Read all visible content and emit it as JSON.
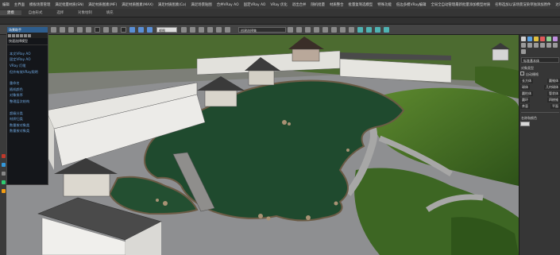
{
  "menu": {
    "items": [
      "编辑",
      "主界面",
      "模板场景管理",
      "满足批量材质(SN)",
      "满足材质图素(MF)",
      "满足材质图素(MAX)",
      "满足材质图素(Co)",
      "满足场景贴图",
      "合并VRay AO",
      "固定VRay AO",
      "VRay 优化",
      "退出合并",
      "随机批量",
      "材质整合",
      "批量复制选模型",
      "特殊功能",
      "低边多模VRay编辑",
      "全局全自动管理最新批量添加模型材质",
      "名称选加以该场景渲染单独添加原件",
      "达可以使用全部文件路"
    ]
  },
  "tabs": {
    "items": [
      "建模",
      "自由形式",
      "选择",
      "对象绘制",
      "填充"
    ],
    "active_index": 0
  },
  "toolbar": {
    "view_select": "视图",
    "set_select": "创建选择集",
    "icon_names": [
      "undo-icon",
      "redo-icon",
      "link-icon",
      "unlink-icon",
      "bind-icon",
      "select-icon",
      "select-name-icon",
      "rect-select-icon",
      "window-icon",
      "move-icon",
      "rotate-icon",
      "scale-icon",
      "ref-coord-icon",
      "pivot-icon",
      "snap-icon",
      "angle-snap-icon",
      "percent-snap-icon",
      "spinner-snap-icon",
      "named-sel-icon",
      "mirror-icon",
      "align-icon",
      "layer-icon",
      "ribbon-icon",
      "curve-icon",
      "schematic-icon",
      "material-icon",
      "render-setup-icon",
      "render-frame-icon",
      "render-icon",
      "teapot-icon"
    ]
  },
  "scene_menu": {
    "title": "场景助手",
    "subtitle": "快速选择模型",
    "groups": [
      [
        "本文VRay AO",
        "固定VRay AO",
        "VRay 灯缆",
        "但外有效VRay照明"
      ],
      [
        "重命名",
        "随机颜色",
        "对象排序",
        "整理层次结构"
      ],
      [
        "超级分类",
        "材质归类",
        "数量按对象类",
        "数量按对象类"
      ]
    ]
  },
  "command_panel": {
    "icon_names": [
      "create-icon",
      "modify-icon",
      "hierarchy-icon",
      "motion-icon",
      "display-icon",
      "utilities-icon",
      "geometry-icon",
      "shapes-icon",
      "lights-icon",
      "cameras-icon",
      "helpers-icon",
      "spacewarps-icon",
      "systems-icon"
    ],
    "dropdown": "标准基本体",
    "section_title": "对象类型",
    "auto_grid_label": "自动栅格",
    "rows": [
      [
        "长方体",
        "圆锥体"
      ],
      [
        "球体",
        "几何球体"
      ],
      [
        "圆柱体",
        "管状体"
      ],
      [
        "圆环",
        "四棱锥"
      ],
      [
        "茶壶",
        "平面"
      ]
    ],
    "name_section": "名称和颜色",
    "swatch_color": "#d8d8d8"
  },
  "viewport": {
    "label": "3D garden scene viewport",
    "colors": {
      "water": "#1f4a2e",
      "paving": "#8d8d8f",
      "lawn": "#3f6a26",
      "wall": "#e7e6e2",
      "roof": "#3a3a3a"
    }
  }
}
